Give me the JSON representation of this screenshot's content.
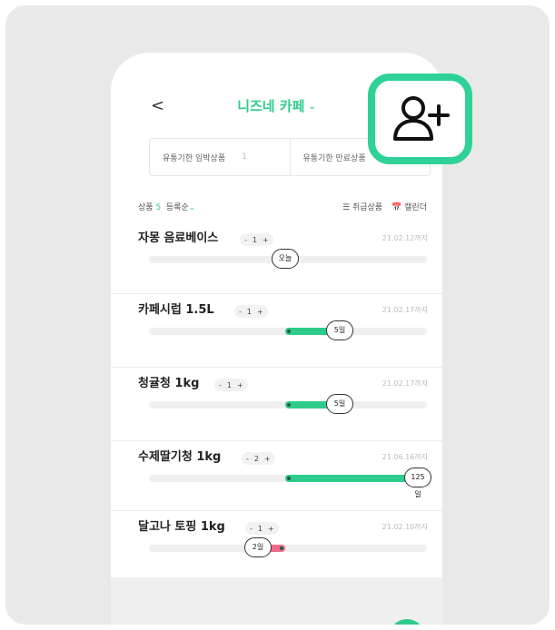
{
  "header": {
    "back_label": "<",
    "title": "니즈네 카페",
    "title_chevron": "⌄"
  },
  "tabs": [
    {
      "label": "유통기한 임박상품",
      "count": "1"
    },
    {
      "label": "유통기한 만료상품",
      "count": ""
    }
  ],
  "toolbar": {
    "product_label": "상품",
    "product_count": "5",
    "sort_label": "등록순",
    "sort_chevron": "⌄",
    "cancelled_label": "☰ 취급상품",
    "calendar_label": "📅 캘린더"
  },
  "items": [
    {
      "name": "자몽 음료베이스",
      "qty": "1",
      "minus": "-",
      "plus": "+",
      "date": "21.02.12까지",
      "badge": "오늘",
      "status": "today",
      "progress": 0
    },
    {
      "name": "카페시럽 1.5L",
      "qty": "1",
      "minus": "-",
      "plus": "+",
      "date": "21.02.17까지",
      "badge": "5일",
      "status": "ok",
      "progress": 0.2
    },
    {
      "name": "청귤청 1kg",
      "qty": "1",
      "minus": "-",
      "plus": "+",
      "date": "21.02.17까지",
      "badge": "5일",
      "status": "ok",
      "progress": 0.2
    },
    {
      "name": "수제딸기청 1kg",
      "qty": "2",
      "minus": "-",
      "plus": "+",
      "date": "21.06.16까지",
      "badge": "125일",
      "status": "ok",
      "progress": 0.48
    },
    {
      "name": "달고나 토핑 1kg",
      "qty": "1",
      "minus": "-",
      "plus": "+",
      "date": "21.02.10까지",
      "badge": "2일",
      "status": "expired",
      "progress": 0.07
    }
  ],
  "colors": {
    "accent": "#2ecc8a",
    "expired": "#f06b86",
    "highlight_border": "#2fd296"
  },
  "icons": {
    "add_member": "add-user-icon"
  }
}
